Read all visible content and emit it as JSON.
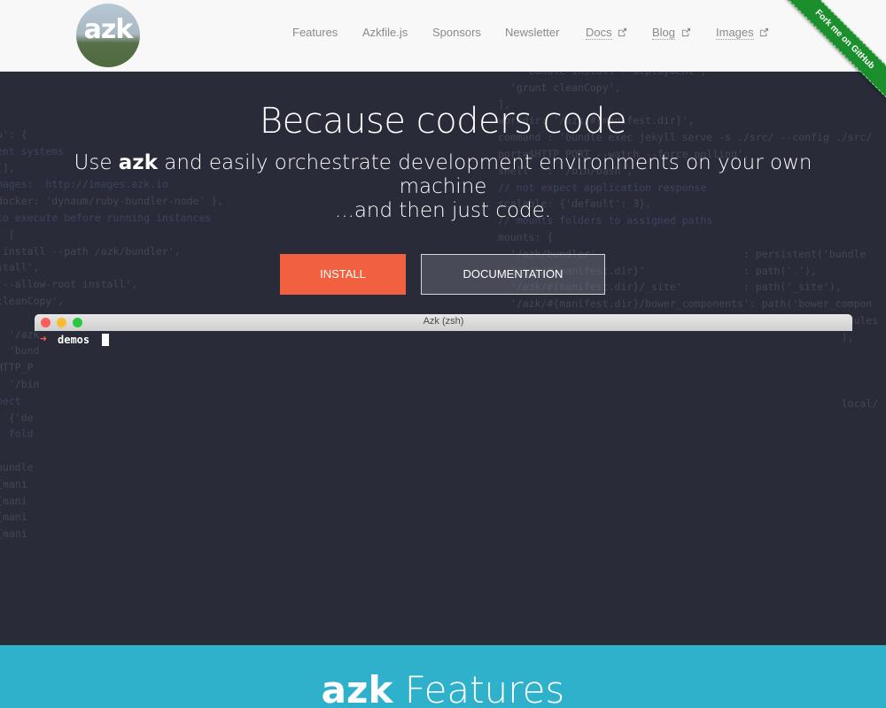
{
  "header": {
    "logo_text": "azk",
    "nav": [
      {
        "label": "Features",
        "external": false
      },
      {
        "label": "Azkfile.js",
        "external": false
      },
      {
        "label": "Sponsors",
        "external": false
      },
      {
        "label": "Newsletter",
        "external": false
      },
      {
        "label": "Docs",
        "external": true
      },
      {
        "label": "Blog",
        "external": true
      },
      {
        "label": "Images",
        "external": true
      }
    ],
    "ribbon_text": "Fork me on GitHub"
  },
  "hero": {
    "title": "Because coders code",
    "subtitle_pre": "Use ",
    "subtitle_brand": "azk",
    "subtitle_post": " and easily orchestrate development environments on your own machine",
    "subtitle_line2": "...and then just code.",
    "install_label": "INSTALL",
    "docs_label": "DOCUMENTATION"
  },
  "terminal": {
    "title": "Azk  (zsh)",
    "prompt_symbol": "➜",
    "prompt_dir": "demos"
  },
  "features": {
    "title_brand": "azk",
    "title_rest": " Features"
  },
  "colors": {
    "accent": "#f1613f",
    "hero_bg": "#292b38",
    "features_bg": "#2fb1cc",
    "ribbon": "#1b8f2c"
  }
}
